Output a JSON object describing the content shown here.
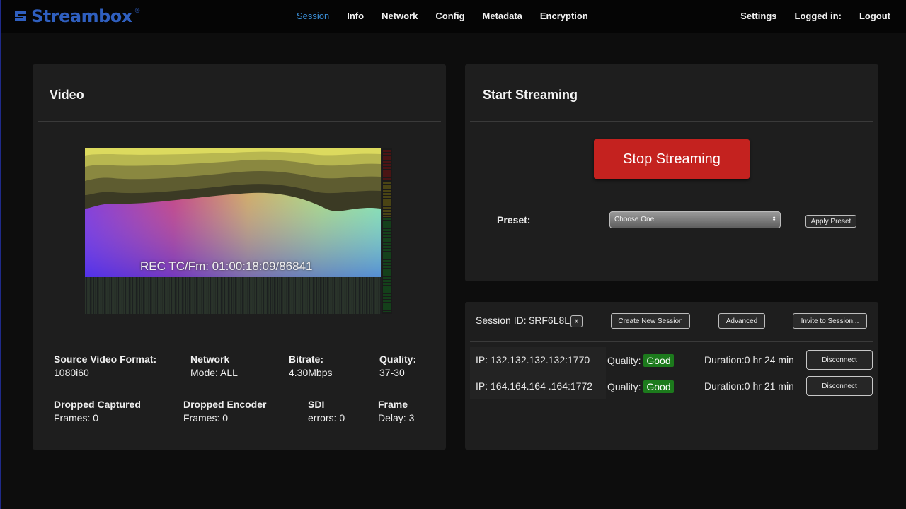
{
  "app": {
    "logo_text": "Streambox",
    "logo_mark": "®"
  },
  "nav": {
    "tabs": [
      "Session",
      "Info",
      "Network",
      "Config",
      "Metadata",
      "Encryption"
    ],
    "active_tab": "Session",
    "settings": "Settings",
    "logged_in": "Logged in:",
    "logout": "Logout"
  },
  "video_panel": {
    "title": "Video",
    "timecode": "REC TC/Fm: 01:00:18:09/86841",
    "stats": {
      "source_format_label": "Source Video Format:",
      "source_format_value": "1080i60",
      "network_label": "Network",
      "network_value": "Mode: ALL",
      "bitrate_label": "Bitrate:",
      "bitrate_value": "4.30Mbps",
      "quality_label": "Quality:",
      "quality_value": "37-30",
      "dropped_captured_label": "Dropped Captured",
      "dropped_captured_value": "Frames: 0",
      "dropped_encoder_label": "Dropped Encoder",
      "dropped_encoder_value": "Frames: 0",
      "sdi_label": "SDI",
      "sdi_value": "errors: 0",
      "frame_delay_label": "Frame",
      "frame_delay_value": "Delay: 3"
    }
  },
  "stream_panel": {
    "title": "Start Streaming",
    "stop_label": "Stop Streaming",
    "preset_label": "Preset:",
    "preset_selected": "Choose One",
    "apply_label": "Apply Preset"
  },
  "session_panel": {
    "session_id": "Session ID: $RF6L8L",
    "close_label": "x",
    "create_label": "Create New Session",
    "advanced_label": "Advanced",
    "invite_label": "Invite to Session...",
    "connections": [
      {
        "ip": "IP: 132.132.132.132:1770",
        "quality_label": "Quality:",
        "quality": "Good",
        "duration": "Duration:0 hr 24 min",
        "action": "Disconnect"
      },
      {
        "ip": "IP: 164.164.164 .164:1772",
        "quality_label": "Quality:",
        "quality": "Good",
        "duration": "Duration:0 hr 21 min",
        "action": "Disconnect"
      }
    ]
  },
  "colors": {
    "accent": "#3a8fd8",
    "stop_button": "#c4221f",
    "good": "#1c7a1c",
    "logo": "#2f5fbf"
  },
  "icons": [
    "streambox-logo-icon",
    "chevron-updown-icon"
  ]
}
